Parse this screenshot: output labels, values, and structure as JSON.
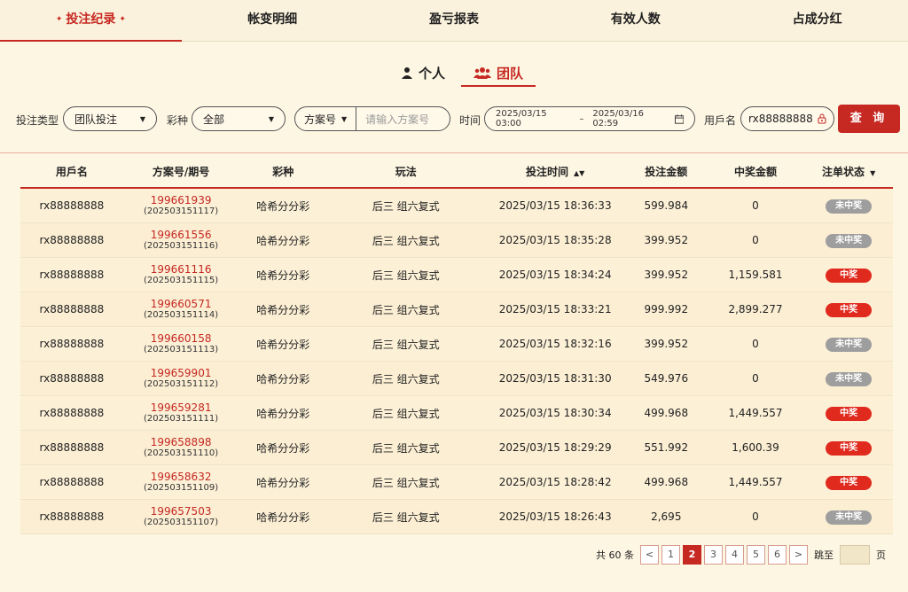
{
  "tabs": [
    {
      "label": "投注纪录",
      "active": true
    },
    {
      "label": "帐变明细",
      "active": false
    },
    {
      "label": "盈亏报表",
      "active": false
    },
    {
      "label": "有效人数",
      "active": false
    },
    {
      "label": "占成分红",
      "active": false
    }
  ],
  "mode": {
    "personal": "个人",
    "team": "团队"
  },
  "filters": {
    "bet_type_label": "投注类型",
    "bet_type_value": "团队投注",
    "lottery_label": "彩种",
    "lottery_value": "全部",
    "scheme_select": "方案号",
    "scheme_placeholder": "请输入方案号",
    "time_label": "时间",
    "time_start": "2025/03/15 03:00",
    "time_sep": "–",
    "time_end": "2025/03/16 02:59",
    "username_label": "用戶名",
    "username_value": "rx88888888",
    "query_button": "查 询"
  },
  "table": {
    "headers": [
      "用戶名",
      "方案号/期号",
      "彩种",
      "玩法",
      "投注时间",
      "投注金额",
      "中奖金额",
      "注单状态"
    ],
    "rows": [
      {
        "user": "rx88888888",
        "no": "199661939",
        "period": "(202503151117)",
        "lottery": "哈希分分彩",
        "play": "后三 组六复式",
        "time": "2025/03/15 18:36:33",
        "amount": "599.984",
        "win": "0",
        "status": "未中奖"
      },
      {
        "user": "rx88888888",
        "no": "199661556",
        "period": "(202503151116)",
        "lottery": "哈希分分彩",
        "play": "后三 组六复式",
        "time": "2025/03/15 18:35:28",
        "amount": "399.952",
        "win": "0",
        "status": "未中奖"
      },
      {
        "user": "rx88888888",
        "no": "199661116",
        "period": "(202503151115)",
        "lottery": "哈希分分彩",
        "play": "后三 组六复式",
        "time": "2025/03/15 18:34:24",
        "amount": "399.952",
        "win": "1,159.581",
        "status": "中奖"
      },
      {
        "user": "rx88888888",
        "no": "199660571",
        "period": "(202503151114)",
        "lottery": "哈希分分彩",
        "play": "后三 组六复式",
        "time": "2025/03/15 18:33:21",
        "amount": "999.992",
        "win": "2,899.277",
        "status": "中奖"
      },
      {
        "user": "rx88888888",
        "no": "199660158",
        "period": "(202503151113)",
        "lottery": "哈希分分彩",
        "play": "后三 组六复式",
        "time": "2025/03/15 18:32:16",
        "amount": "399.952",
        "win": "0",
        "status": "未中奖"
      },
      {
        "user": "rx88888888",
        "no": "199659901",
        "period": "(202503151112)",
        "lottery": "哈希分分彩",
        "play": "后三 组六复式",
        "time": "2025/03/15 18:31:30",
        "amount": "549.976",
        "win": "0",
        "status": "未中奖"
      },
      {
        "user": "rx88888888",
        "no": "199659281",
        "period": "(202503151111)",
        "lottery": "哈希分分彩",
        "play": "后三 组六复式",
        "time": "2025/03/15 18:30:34",
        "amount": "499.968",
        "win": "1,449.557",
        "status": "中奖"
      },
      {
        "user": "rx88888888",
        "no": "199658898",
        "period": "(202503151110)",
        "lottery": "哈希分分彩",
        "play": "后三 组六复式",
        "time": "2025/03/15 18:29:29",
        "amount": "551.992",
        "win": "1,600.39",
        "status": "中奖"
      },
      {
        "user": "rx88888888",
        "no": "199658632",
        "period": "(202503151109)",
        "lottery": "哈希分分彩",
        "play": "后三 组六复式",
        "time": "2025/03/15 18:28:42",
        "amount": "499.968",
        "win": "1,449.557",
        "status": "中奖"
      },
      {
        "user": "rx88888888",
        "no": "199657503",
        "period": "(202503151107)",
        "lottery": "哈希分分彩",
        "play": "后三 组六复式",
        "time": "2025/03/15 18:26:43",
        "amount": "2,695",
        "win": "0",
        "status": "未中奖"
      }
    ]
  },
  "pagination": {
    "total": "共 60 条",
    "prev": "<",
    "pages": [
      "1",
      "2",
      "3",
      "4",
      "5",
      "6"
    ],
    "current": "2",
    "next": ">",
    "jump_label": "跳至",
    "page_unit": "页"
  },
  "colors": {
    "accent": "#c62822",
    "win_badge": "#e02a1e",
    "lose_badge": "#9e9e9e",
    "background": "#fdf6e3"
  },
  "icons": {
    "personal": "user-icon",
    "team": "users-icon",
    "lock": "lock-icon",
    "calendar": "calendar-icon",
    "sort": "sort-icon",
    "filter": "filter-down-icon"
  }
}
